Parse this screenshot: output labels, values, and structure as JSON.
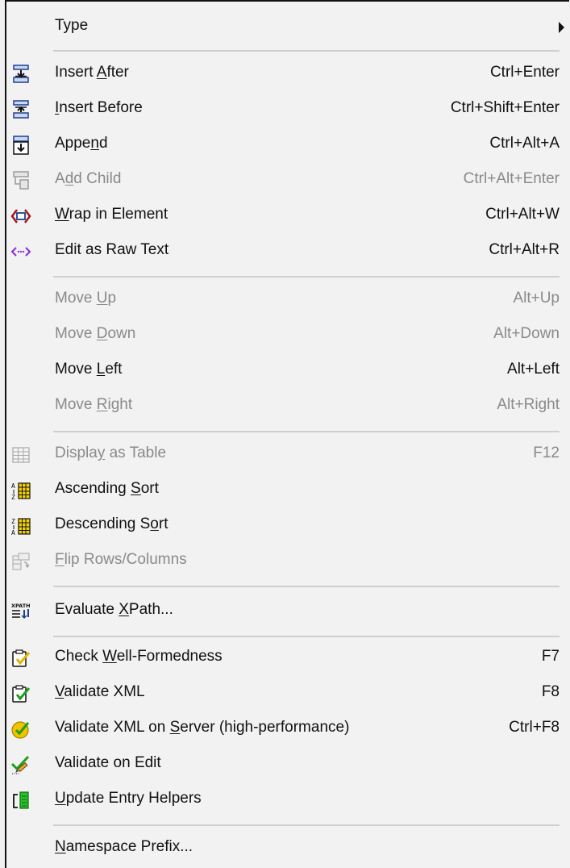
{
  "menu": {
    "type": {
      "label": "Type"
    },
    "insert_after": {
      "label_pre": "Insert ",
      "label_u": "A",
      "label_post": "fter",
      "shortcut": "Ctrl+Enter",
      "icon": "insert-after-icon"
    },
    "insert_before": {
      "label_pre": "",
      "label_u": "I",
      "label_post": "nsert Before",
      "shortcut": "Ctrl+Shift+Enter",
      "icon": "insert-before-icon"
    },
    "append": {
      "label_pre": "Appe",
      "label_u": "n",
      "label_post": "d",
      "shortcut": "Ctrl+Alt+A",
      "icon": "append-icon"
    },
    "add_child": {
      "label_pre": "A",
      "label_u": "d",
      "label_post": "d Child",
      "shortcut": "Ctrl+Alt+Enter",
      "icon": "add-child-icon"
    },
    "wrap_in_element": {
      "label_pre": "",
      "label_u": "W",
      "label_post": "rap in Element",
      "shortcut": "Ctrl+Alt+W",
      "icon": "wrap-element-icon"
    },
    "edit_raw_text": {
      "label": "Edit as Raw Text",
      "shortcut": "Ctrl+Alt+R",
      "icon": "raw-text-icon"
    },
    "move_up": {
      "label_pre": "Move ",
      "label_u": "U",
      "label_post": "p",
      "shortcut": "Alt+Up"
    },
    "move_down": {
      "label_pre": "Move ",
      "label_u": "D",
      "label_post": "own",
      "shortcut": "Alt+Down"
    },
    "move_left": {
      "label_pre": "Move ",
      "label_u": "L",
      "label_post": "eft",
      "shortcut": "Alt+Left"
    },
    "move_right": {
      "label_pre": "Move ",
      "label_u": "R",
      "label_post": "ight",
      "shortcut": "Alt+Right"
    },
    "display_as_table": {
      "label_pre": "Displa",
      "label_u": "y",
      "label_post": " as Table",
      "shortcut": "F12",
      "icon": "table-icon"
    },
    "ascending_sort": {
      "label_pre": "Ascending ",
      "label_u": "S",
      "label_post": "ort",
      "icon": "sort-ascending-icon"
    },
    "descending_sort": {
      "label_pre": "Descending S",
      "label_u": "o",
      "label_post": "rt",
      "icon": "sort-descending-icon"
    },
    "flip_rows_columns": {
      "label_pre": "",
      "label_u": "F",
      "label_post": "lip Rows/Columns",
      "icon": "flip-rows-columns-icon"
    },
    "evaluate_xpath": {
      "label_pre": "Evaluate ",
      "label_u": "X",
      "label_post": "Path...",
      "icon": "xpath-icon",
      "icon_text": "XPATH"
    },
    "check_wellformedness": {
      "label_pre": "Check ",
      "label_u": "W",
      "label_post": "ell-Formedness",
      "shortcut": "F7",
      "icon": "check-wellformed-icon"
    },
    "validate_xml": {
      "label_pre": "",
      "label_u": "V",
      "label_post": "alidate XML",
      "shortcut": "F8",
      "icon": "validate-xml-icon"
    },
    "validate_on_server": {
      "label_pre": "Validate XML on ",
      "label_u": "S",
      "label_post": "erver (high-performance)",
      "shortcut": "Ctrl+F8",
      "icon": "validate-server-icon"
    },
    "validate_on_edit": {
      "label": "Validate on Edit",
      "icon": "validate-on-edit-icon"
    },
    "update_entry_helpers": {
      "label_pre": "",
      "label_u": "U",
      "label_post": "pdate Entry Helpers",
      "icon": "entry-helpers-icon"
    },
    "namespace_prefix": {
      "label_pre": "",
      "label_u": "N",
      "label_post": "amespace Prefix..."
    }
  },
  "colors": {
    "enabled_text": "#111111",
    "disabled_text": "#8a8a8a",
    "menu_background": "#f2f2f2",
    "separator": "#cfcfcf",
    "blue_icon": "#1f3f8f",
    "red_icon": "#a01a1a",
    "purple_icon": "#8a2be2",
    "green_check": "#1aa01a",
    "gold_check": "#e0b400"
  }
}
